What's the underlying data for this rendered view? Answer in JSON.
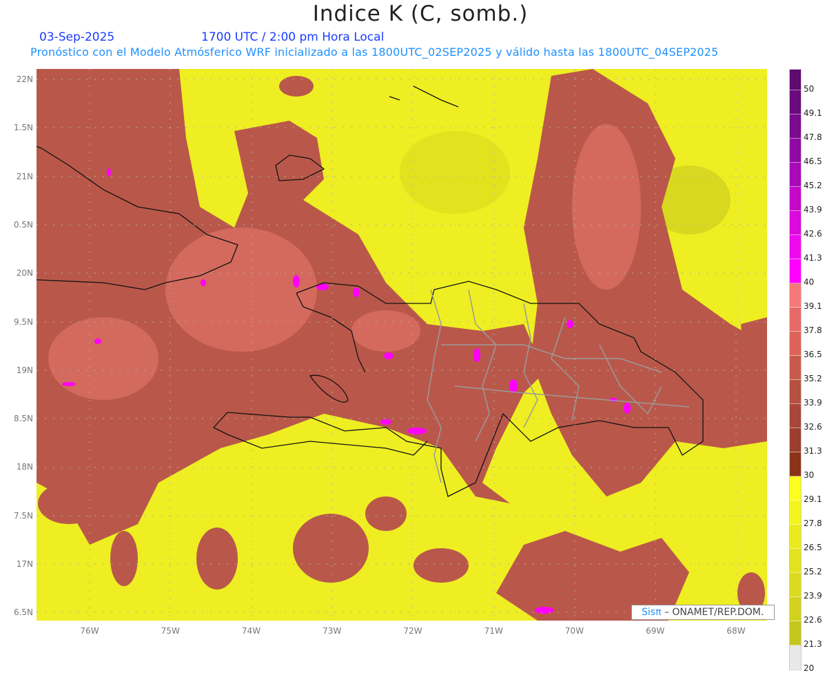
{
  "header": {
    "title": "Indice K (C, somb.)",
    "date": "03-Sep-2025",
    "time": "1700 UTC / 2:00 pm Hora Local",
    "subtitle": "Pronóstico con el Modelo Atmósferico WRF inicializado a las 1800UTC_02SEP2025 y válido hasta las  1800UTC_04SEP2025"
  },
  "axes": {
    "lat_labels": [
      "22N",
      "1.5N",
      "21N",
      "0.5N",
      "20N",
      "9.5N",
      "19N",
      "8.5N",
      "18N",
      "7.5N",
      "17N",
      "6.5N"
    ],
    "lon_labels": [
      "76W",
      "75W",
      "74W",
      "73W",
      "72W",
      "71W",
      "70W",
      "69W",
      "68W"
    ]
  },
  "colorbar": {
    "labels": [
      "50",
      "49.1",
      "47.8",
      "46.5",
      "45.2",
      "43.9",
      "42.6",
      "41.3",
      "40",
      "39.1",
      "37.8",
      "36.5",
      "35.2",
      "33.9",
      "32.6",
      "31.3",
      "30",
      "29.1",
      "27.8",
      "26.5",
      "25.2",
      "23.9",
      "22.6",
      "21.3",
      "20"
    ],
    "colors": [
      "#5e0a6e",
      "#6a0a7e",
      "#7a0a8e",
      "#8e0aa4",
      "#a80ab8",
      "#c40ac8",
      "#dc0adc",
      "#ee0aee",
      "#ff00ff",
      "#f47a78",
      "#e86a66",
      "#dc6456",
      "#c85a4a",
      "#b65040",
      "#a8463a",
      "#9c3e2e",
      "#8c3418",
      "#fdfd1e",
      "#f4f41e",
      "#eaea1e",
      "#e2e21e",
      "#dada1e",
      "#d2d21e",
      "#c6c61e",
      "#e8e8e8"
    ]
  },
  "watermark": {
    "brand": "Sisπ",
    "text": " –  ONAMET/REP.DOM."
  }
}
